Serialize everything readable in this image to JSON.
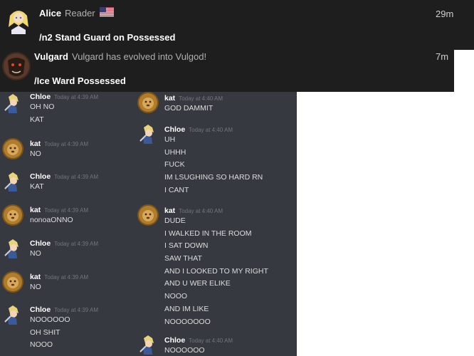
{
  "notifications": {
    "alice": {
      "name": "Alice",
      "role": "Reader",
      "flag_icon": "us-flag-icon",
      "time": "29m",
      "command": "/n2 Stand Guard on Possessed"
    },
    "vulgard": {
      "name": "Vulgard",
      "subtitle": "Vulgard has evolved into Vulgod!",
      "time": "7m",
      "command": "/Ice Ward Possessed"
    }
  },
  "chat_left": {
    "messages": [
      {
        "user": "Chloe",
        "time": "Today at 4:39 AM",
        "lines": [
          "OH NO",
          "KAT"
        ]
      },
      {
        "user": "kat",
        "time": "Today at 4:39 AM",
        "lines": [
          "NO"
        ]
      },
      {
        "user": "Chloe",
        "time": "Today at 4:39 AM",
        "lines": [
          "KAT"
        ]
      },
      {
        "user": "kat",
        "time": "Today at 4:39 AM",
        "lines": [
          "nonoaONNO"
        ]
      },
      {
        "user": "Chloe",
        "time": "Today at 4:39 AM",
        "lines": [
          "NO"
        ]
      },
      {
        "user": "kat",
        "time": "Today at 4:39 AM",
        "lines": [
          "NO"
        ]
      },
      {
        "user": "Chloe",
        "time": "Today at 4:39 AM",
        "lines": [
          "NOOOOOO",
          "OH SHIT",
          "NOOO"
        ]
      }
    ]
  },
  "chat_right": {
    "messages": [
      {
        "user": "kat",
        "time": "Today at 4:40 AM",
        "lines": [
          "GOD DAMMIT"
        ]
      },
      {
        "user": "Chloe",
        "time": "Today at 4:40 AM",
        "lines": [
          "UH",
          "UHHH",
          "FUCK",
          "IM LSUGHING SO HARD RN",
          "I CANT"
        ]
      },
      {
        "user": "kat",
        "time": "Today at 4:40 AM",
        "lines": [
          "DUDE",
          "I WALKED IN THE ROOM",
          "I SAT DOWN",
          "SAW THAT",
          "AND I LOOKED TO MY RIGHT",
          "AND U WER ELIKE",
          "NOOO",
          "AND IM LIKE",
          "NOOOOOOO"
        ]
      },
      {
        "user": "Chloe",
        "time": "Today at 4:40 AM",
        "lines": [
          "NOOOOOO"
        ]
      }
    ]
  },
  "colors": {
    "chat_bg": "#36393f",
    "notif_bg": "#1e1e1e",
    "username": "#ffffff",
    "timestamp": "#72767d",
    "message_text": "#dcddde"
  }
}
